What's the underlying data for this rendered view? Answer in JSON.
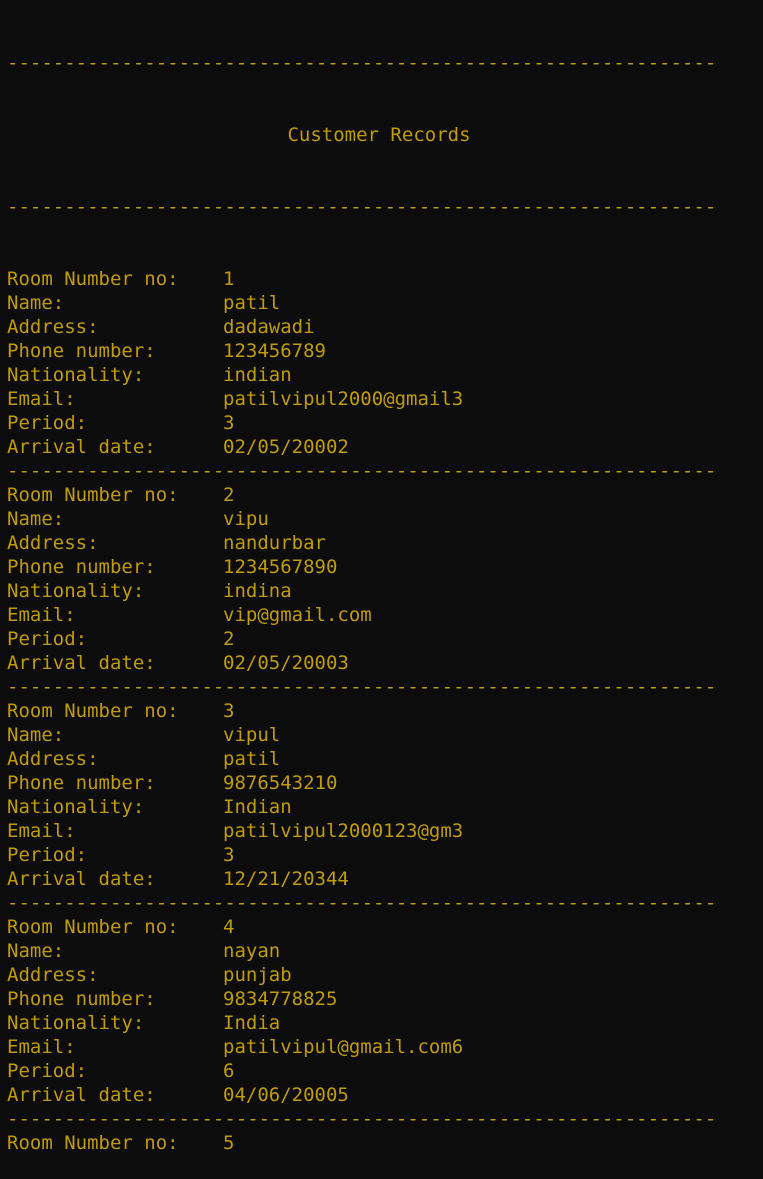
{
  "theme": {
    "background": "#0c0c0c",
    "foreground": "#c19c00"
  },
  "separator": "--------------------------------------------------------------",
  "title": "Customer Records",
  "labels": {
    "room": "Room Number no:",
    "name": "Name:",
    "address": "Address:",
    "phone": "Phone number:",
    "nationality": "Nationality:",
    "email": "Email:",
    "period": "Period:",
    "arrival": "Arrival date:"
  },
  "records": [
    {
      "room": "1",
      "name": "patil",
      "address": "dadawadi",
      "phone": "123456789",
      "nationality": "indian",
      "email": "patilvipul2000@gmail3",
      "period": "3",
      "arrival": "02/05/20002"
    },
    {
      "room": "2",
      "name": "vipu",
      "address": "nandurbar",
      "phone": "1234567890",
      "nationality": "indina",
      "email": "vip@gmail.com",
      "period": "2",
      "arrival": "02/05/20003"
    },
    {
      "room": "3",
      "name": "vipul",
      "address": "patil",
      "phone": "9876543210",
      "nationality": "Indian",
      "email": "patilvipul2000123@gm3",
      "period": "3",
      "arrival": "12/21/20344"
    },
    {
      "room": "4",
      "name": "nayan",
      "address": "punjab",
      "phone": "9834778825",
      "nationality": "India",
      "email": "patilvipul@gmail.com6",
      "period": "6",
      "arrival": "04/06/20005"
    },
    {
      "room": "5"
    }
  ]
}
